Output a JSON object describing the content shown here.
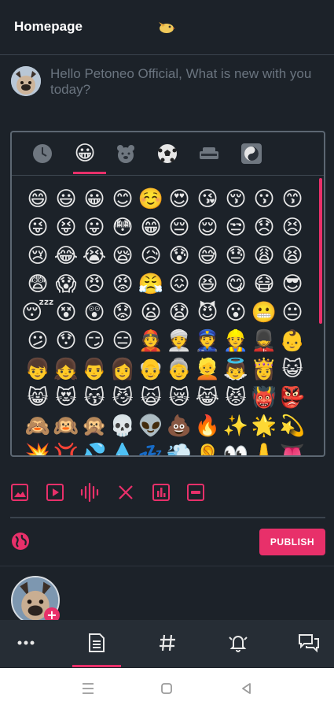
{
  "header": {
    "title": "Homepage",
    "logo_icon": "bird-icon"
  },
  "compose": {
    "placeholder": "Hello Petoneo Official, What is new with you today?"
  },
  "emoji_tabs": [
    "clock-icon",
    "smiley-icon",
    "bear-icon",
    "soccer-ball-icon",
    "car-icon",
    "yin-yang-icon"
  ],
  "emoji_rows": [
    [
      "😄",
      "😃",
      "😀",
      "😊",
      "☺️",
      "😍",
      "😘",
      "😚",
      "😗",
      "😙"
    ],
    [
      "😜",
      "😝",
      "😛",
      "😳",
      "😁",
      "😔",
      "😌",
      "😒",
      "😞",
      "😣"
    ],
    [
      "😢",
      "😂",
      "😭",
      "😪",
      "😥",
      "😰",
      "😅",
      "😓",
      "😩",
      "😫"
    ],
    [
      "😨",
      "😱",
      "😠",
      "😡",
      "😤",
      "😖",
      "😆",
      "😋",
      "😷",
      "😎"
    ],
    [
      "😴",
      "😵",
      "😲",
      "😟",
      "😦",
      "😧",
      "😈",
      "😮",
      "😬",
      "😐"
    ],
    [
      "😕",
      "😯",
      "😏",
      "😑",
      "👲",
      "👳",
      "👮",
      "👷",
      "💂",
      "👶"
    ],
    [
      "👦",
      "👧",
      "👨",
      "👩",
      "👴",
      "👵",
      "👱",
      "👼",
      "👸",
      "😺"
    ],
    [
      "😸",
      "😻",
      "😽",
      "😼",
      "🙀",
      "😿",
      "😹",
      "😾",
      "👹",
      "👺"
    ],
    [
      "🙈",
      "🙉",
      "🙊",
      "💀",
      "👽",
      "💩",
      "🔥",
      "✨",
      "🌟",
      "💫"
    ],
    [
      "💥",
      "💢",
      "💦",
      "💧",
      "💤",
      "💨",
      "👂",
      "👀",
      "👃",
      "👅"
    ]
  ],
  "toolbar": [
    "image-icon",
    "video-icon",
    "audio-wave-icon",
    "close-icon",
    "chart-icon",
    "gif-icon"
  ],
  "publish": {
    "label": "PUBLISH"
  },
  "colors": {
    "accent": "#e8306a",
    "background": "#1c2229",
    "nav": "#262d35"
  },
  "bottom_nav": [
    "more-icon",
    "feed-icon",
    "hashtag-icon",
    "notifications-icon",
    "messages-icon"
  ]
}
